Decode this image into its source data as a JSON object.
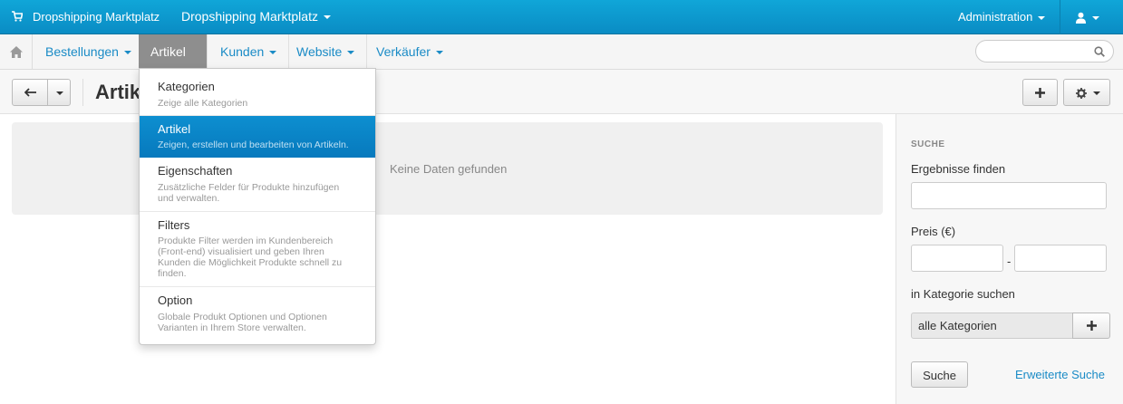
{
  "topbar": {
    "brand": "Dropshipping Marktplatz",
    "store": "Dropshipping Marktplatz",
    "admin": "Administration",
    "cart_icon": "shopping-cart-icon",
    "user_icon": "user-icon"
  },
  "nav": {
    "home_icon": "home-icon",
    "items": [
      {
        "label": "Bestellungen"
      },
      {
        "label": "Artikel"
      },
      {
        "label": "Kunden"
      },
      {
        "label": "Website"
      },
      {
        "label": "Verkäufer"
      }
    ],
    "search_placeholder": ""
  },
  "toolbar": {
    "title": "Artikel"
  },
  "main": {
    "empty": "Keine Daten gefunden"
  },
  "sidebar": {
    "heading": "SUCHE",
    "find_label": "Ergebnisse finden",
    "find_value": "",
    "price_label": "Preis (€)",
    "price_from": "",
    "price_to": "",
    "dash": "-",
    "category_label": "in Kategorie suchen",
    "category_value": "alle Kategorien",
    "search_button": "Suche",
    "advanced_search": "Erweiterte Suche"
  },
  "dropdown": {
    "items": [
      {
        "title": "Kategorien",
        "desc": "Zeige alle Kategorien"
      },
      {
        "title": "Artikel",
        "desc": "Zeigen, erstellen und bearbeiten von Artikeln."
      },
      {
        "title": "Eigenschaften",
        "desc": "Zusätzliche Felder für Produkte hinzufügen und verwalten."
      },
      {
        "title": "Filters",
        "desc": "Produkte Filter werden im Kundenbereich (Front-end) visualisiert und geben Ihren Kunden die Möglichkeit Produkte schnell zu finden."
      },
      {
        "title": "Option",
        "desc": "Globale Produkt Optionen und Optionen Varianten in Ihrem Store verwalten."
      }
    ]
  },
  "colors": {
    "topbar": "#0a8cc4",
    "accent": "#1a8bc6",
    "active_nav": "#8e8e8e",
    "dropdown_active": "#0779bd"
  }
}
